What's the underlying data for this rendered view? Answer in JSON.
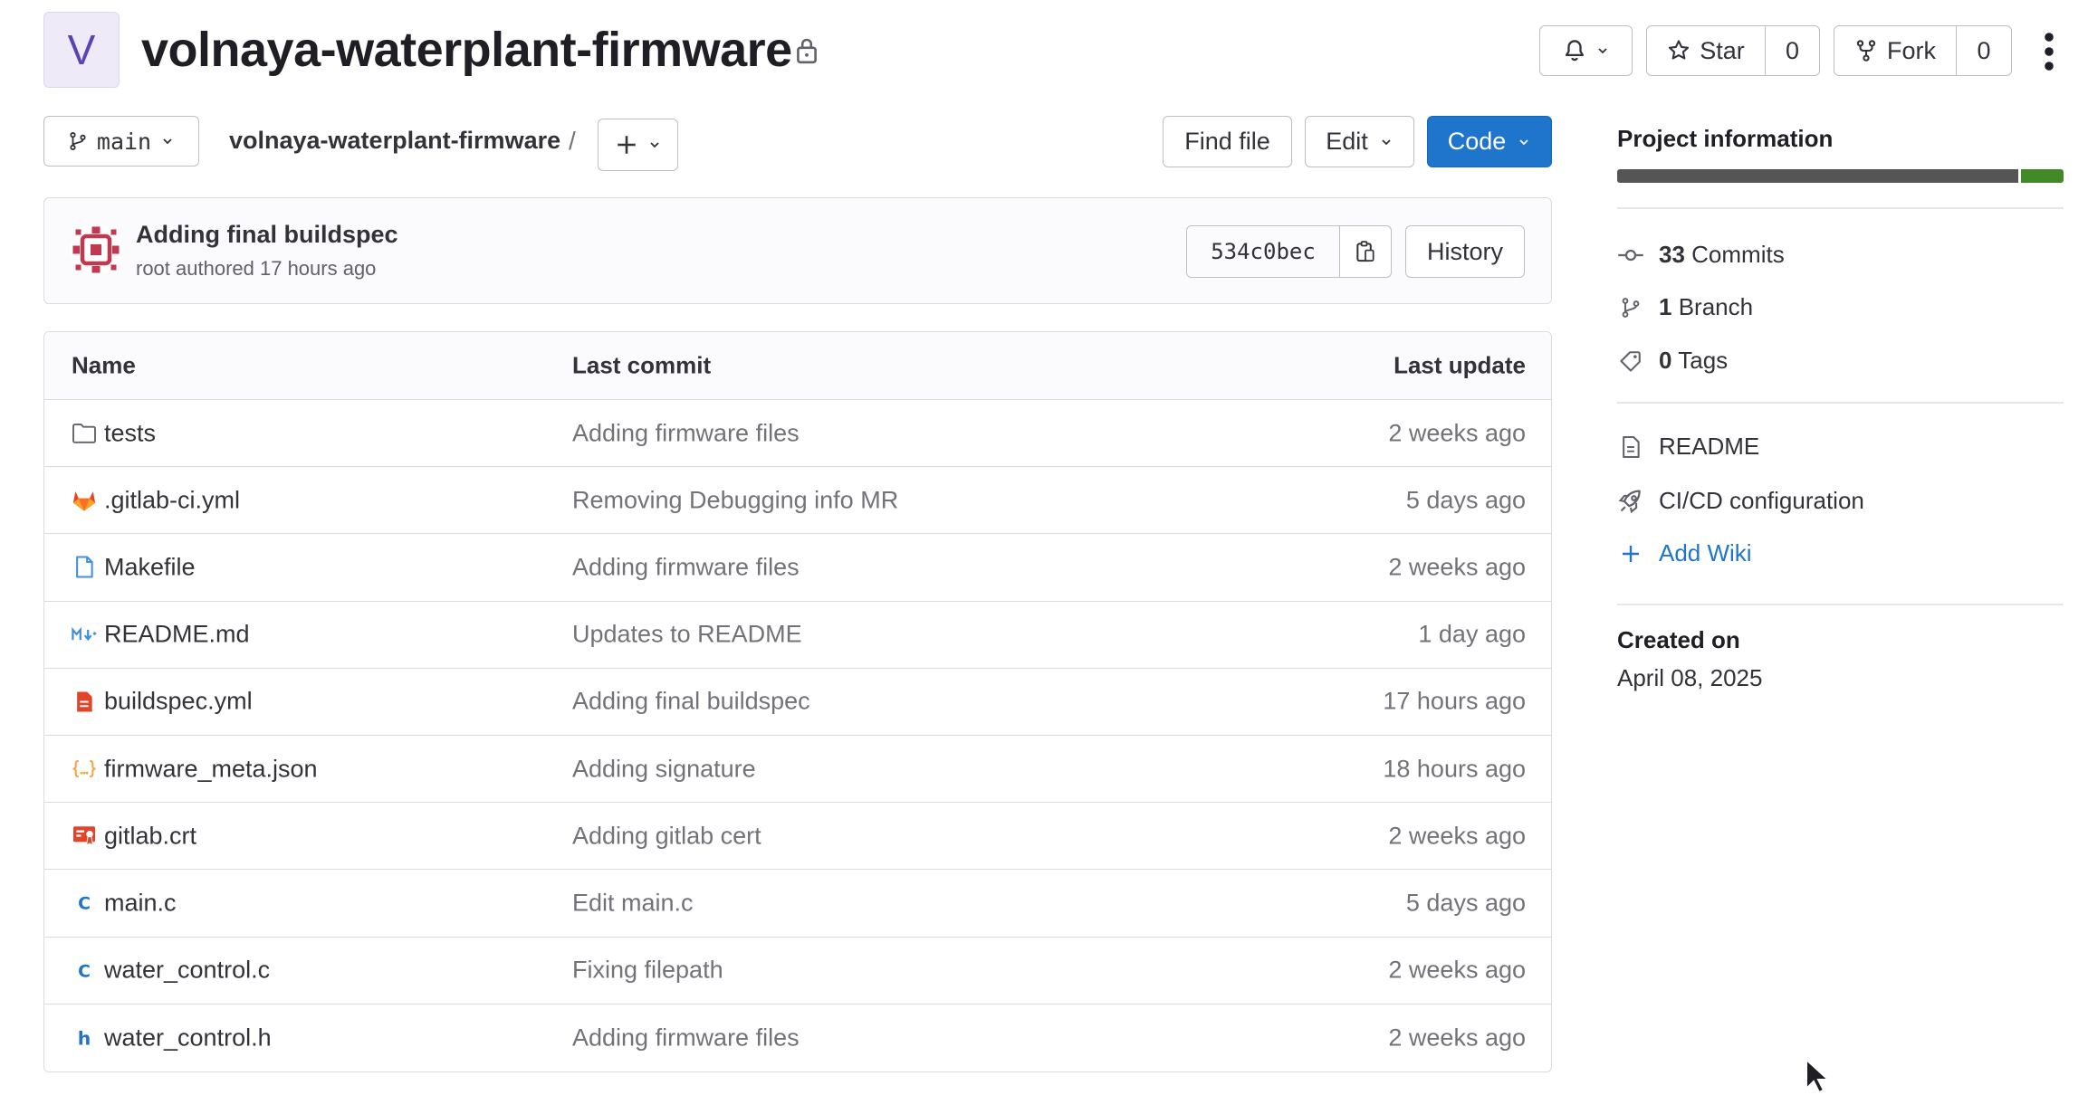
{
  "project": {
    "avatar_letter": "V",
    "name": "volnaya-waterplant-firmware"
  },
  "header": {
    "star_label": "Star",
    "star_count": "0",
    "fork_label": "Fork",
    "fork_count": "0"
  },
  "toolbar": {
    "branch": "main",
    "breadcrumb": "volnaya-waterplant-firmware",
    "breadcrumb_sep": "/",
    "find_file": "Find file",
    "edit": "Edit",
    "code": "Code"
  },
  "last_commit": {
    "title": "Adding final buildspec",
    "meta": "root authored 17 hours ago",
    "sha": "534c0bec",
    "history": "History"
  },
  "table": {
    "headers": {
      "name": "Name",
      "last_commit": "Last commit",
      "last_update": "Last update"
    },
    "rows": [
      {
        "icon": "folder-icon",
        "name": "tests",
        "commit": "Adding firmware files",
        "updated": "2 weeks ago"
      },
      {
        "icon": "gitlab-icon",
        "name": ".gitlab-ci.yml",
        "commit": "Removing Debugging info MR",
        "updated": "5 days ago"
      },
      {
        "icon": "file-icon",
        "name": "Makefile",
        "commit": "Adding firmware files",
        "updated": "2 weeks ago"
      },
      {
        "icon": "markdown-icon",
        "name": "README.md",
        "commit": "Updates to README",
        "updated": "1 day ago"
      },
      {
        "icon": "yaml-icon",
        "name": "buildspec.yml",
        "commit": "Adding final buildspec",
        "updated": "17 hours ago"
      },
      {
        "icon": "json-icon",
        "name": "firmware_meta.json",
        "commit": "Adding signature",
        "updated": "18 hours ago"
      },
      {
        "icon": "certificate-icon",
        "name": "gitlab.crt",
        "commit": "Adding gitlab cert",
        "updated": "2 weeks ago"
      },
      {
        "icon": "c-file-icon",
        "name": "main.c",
        "commit": "Edit main.c",
        "updated": "5 days ago"
      },
      {
        "icon": "c-file-icon",
        "name": "water_control.c",
        "commit": "Fixing filepath",
        "updated": "2 weeks ago"
      },
      {
        "icon": "h-file-icon",
        "name": "water_control.h",
        "commit": "Adding firmware files",
        "updated": "2 weeks ago"
      }
    ]
  },
  "sidebar": {
    "title": "Project information",
    "language_bar": [
      {
        "color": "#555555",
        "share": 0.905
      },
      {
        "color": "#428a27",
        "share": 0.095
      }
    ],
    "commits_count": "33",
    "commits_label": "Commits",
    "branch_count": "1",
    "branch_label": "Branch",
    "tags_count": "0",
    "tags_label": "Tags",
    "readme": "README",
    "cicd": "CI/CD configuration",
    "add_wiki": "Add Wiki",
    "created_label": "Created on",
    "created_value": "April 08, 2025"
  },
  "colors": {
    "accent": "#1f75cb",
    "avatar_bg": "#eeeaf7",
    "avatar_fg": "#5943b5"
  }
}
